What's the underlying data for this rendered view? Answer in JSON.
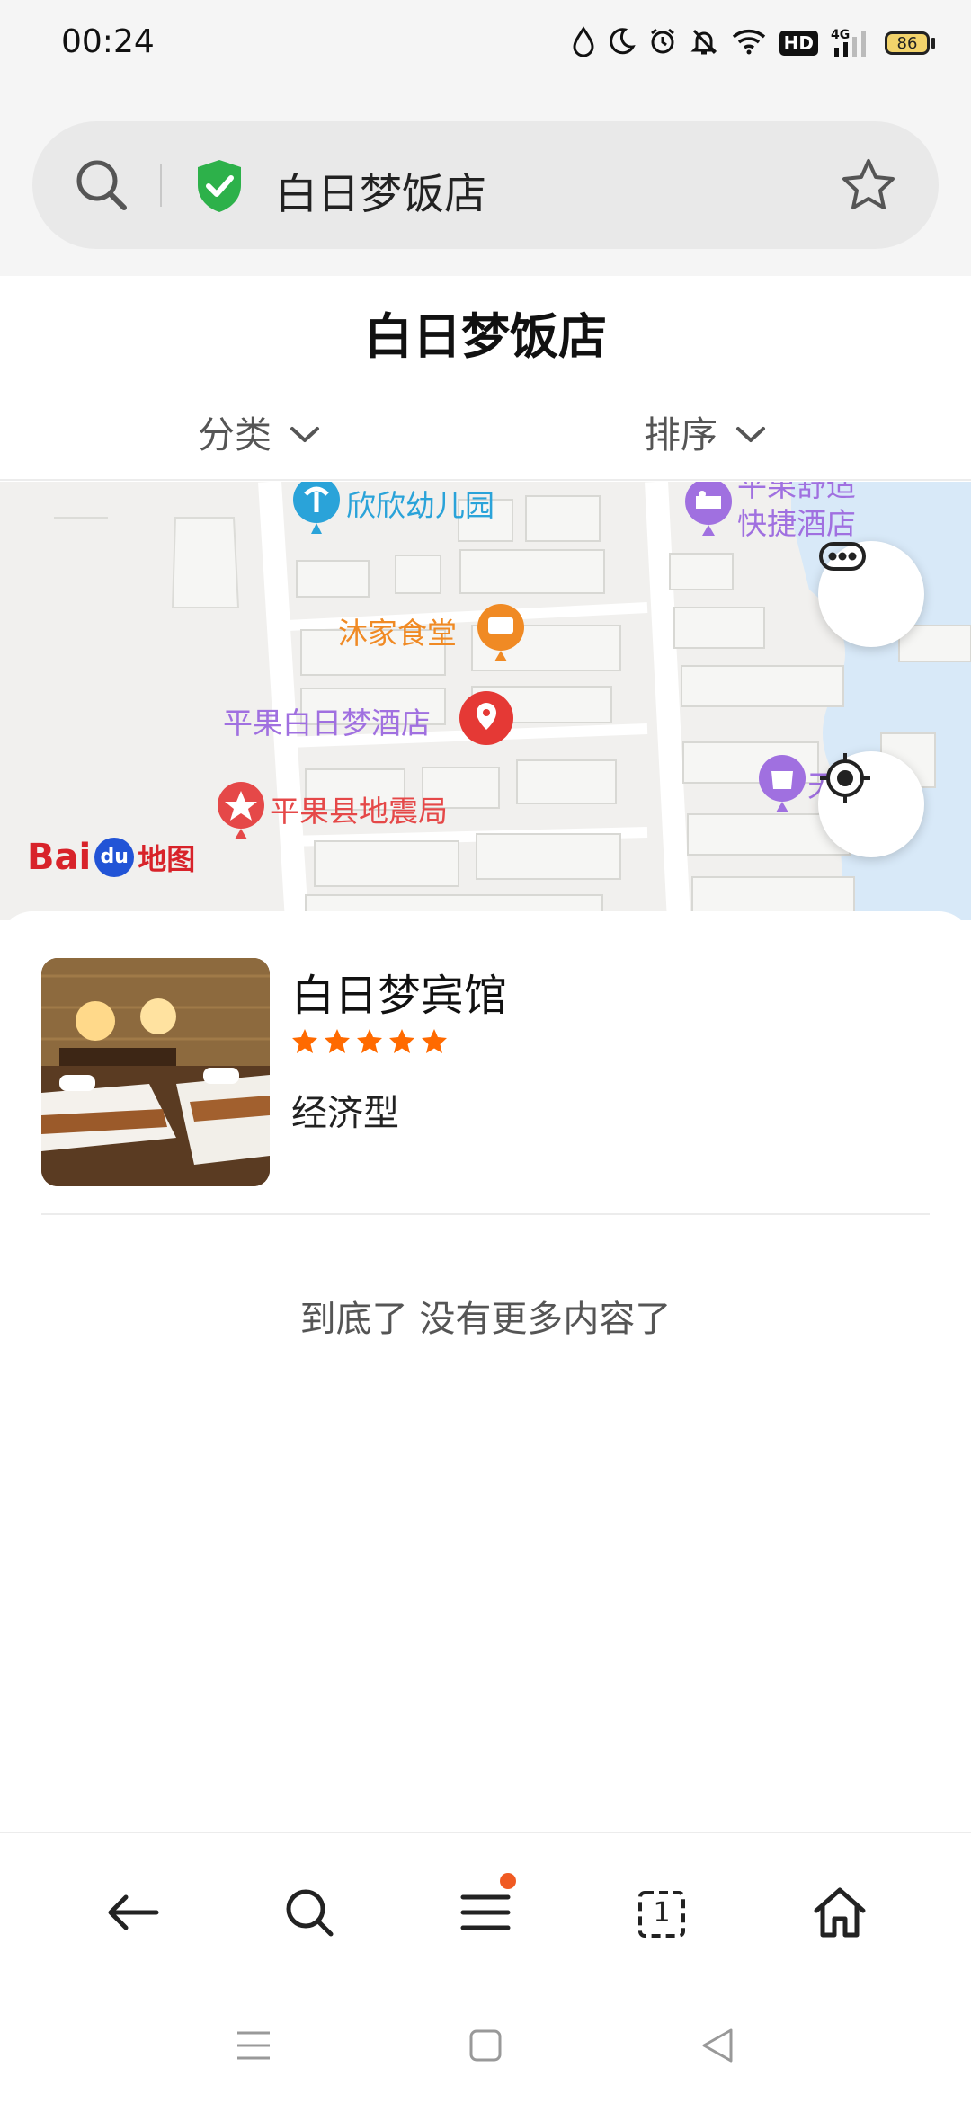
{
  "status_bar": {
    "time": "00:24",
    "network": "4G",
    "hd_label": "HD",
    "battery_level": "86",
    "icons": [
      "water-drop-icon",
      "moon-icon",
      "alarm-icon",
      "bell-off-icon",
      "wifi-icon",
      "signal-icon"
    ]
  },
  "browser": {
    "url_text": "白日梦饭店",
    "icons": [
      "search-icon",
      "shield-check-icon",
      "star-icon"
    ]
  },
  "page": {
    "title": "白日梦饭店",
    "filters": {
      "category_label": "分类",
      "sort_label": "排序"
    }
  },
  "map": {
    "pois": [
      {
        "label": "欣欣幼儿园",
        "color": "#2aa3d9"
      },
      {
        "label": "沐家食堂",
        "color": "#f08a24"
      },
      {
        "label": "平果白日梦酒店",
        "color": "#a070e0"
      },
      {
        "label": "平果县地震局",
        "color": "#e54848"
      },
      {
        "label": "平果舒适",
        "color": "#a070e0"
      },
      {
        "label": "快捷酒店",
        "color": "#a070e0"
      },
      {
        "label": "天",
        "color": "#a070e0"
      }
    ],
    "logo": {
      "brand_left": "Bai",
      "brand_du": "du",
      "map_text": "地图"
    },
    "colors": {
      "land": "#f1f0ee",
      "block": "#f6f6f4",
      "road": "#ffffff",
      "water": "#d8e9f8"
    }
  },
  "results": [
    {
      "name": "白日梦宾馆",
      "stars": 5,
      "type": "经济型"
    }
  ],
  "end_message": "到底了 没有更多内容了",
  "bottom_nav": {
    "items": [
      "back-arrow-icon",
      "search-icon",
      "menu-icon",
      "tabs-icon",
      "home-icon"
    ],
    "tab_count": "1"
  },
  "accent_colors": {
    "star": "#ff6a00",
    "shield": "#2db14a",
    "notification": "#f05a22",
    "marker_red": "#e53935"
  }
}
